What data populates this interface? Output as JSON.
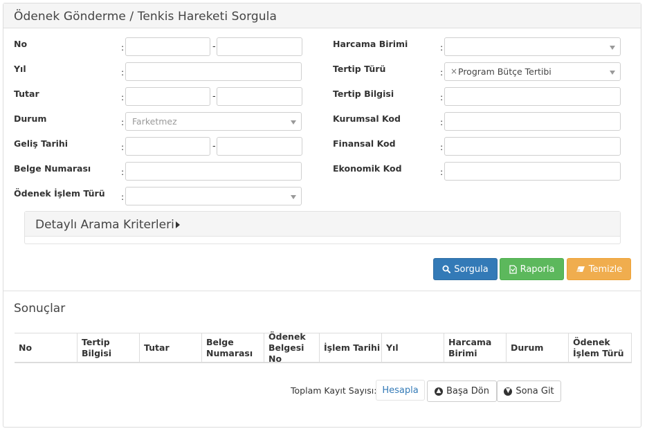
{
  "panel": {
    "title": "Ödenek Gönderme / Tenkis Hareketi Sorgula"
  },
  "form_left": {
    "no": {
      "label": "No",
      "colon": ":",
      "dash": "-"
    },
    "yil": {
      "label": "Yıl",
      "colon": ":"
    },
    "tutar": {
      "label": "Tutar",
      "colon": ":",
      "dash": "-"
    },
    "durum": {
      "label": "Durum",
      "colon": ":",
      "selected": "Farketmez"
    },
    "gelis_tarihi": {
      "label": "Geliş Tarihi",
      "colon": ":",
      "dash": "-"
    },
    "belge_numarasi": {
      "label": "Belge Numarası",
      "colon": ":"
    },
    "odenek_islem_turu": {
      "label": "Ödenek İşlem Türü",
      "colon": ":",
      "selected": ""
    }
  },
  "form_right": {
    "harcama_birimi": {
      "label": "Harcama Birimi",
      "colon": ":",
      "selected": ""
    },
    "tertip_turu": {
      "label": "Tertip Türü",
      "colon": ":",
      "tag_remove": "×",
      "selected": "Program Bütçe Tertibi"
    },
    "tertip_bilgisi": {
      "label": "Tertip Bilgisi",
      "colon": ":"
    },
    "kurumsal_kod": {
      "label": "Kurumsal Kod",
      "colon": ":"
    },
    "finansal_kod": {
      "label": "Finansal Kod",
      "colon": ":"
    },
    "ekonomik_kod": {
      "label": "Ekonomik Kod",
      "colon": ":"
    }
  },
  "detail": {
    "title": "Detaylı Arama Kriterleri"
  },
  "actions": {
    "query_label": "Sorgula",
    "report_label": "Raporla",
    "clear_label": "Temizle"
  },
  "results": {
    "title": "Sonuçlar",
    "columns": [
      "No",
      "Tertip Bilgisi",
      "Tutar",
      "Belge Numarası",
      "Ödenek Belgesi No",
      "İşlem Tarihi",
      "Yıl",
      "Harcama Birimi",
      "Durum",
      "Ödenek İşlem Türü"
    ]
  },
  "footer": {
    "total_label": "Toplam Kayıt Sayısı:",
    "calculate_label": "Hesapla",
    "first_label": "Başa Dön",
    "last_label": "Sona Git"
  },
  "colors": {
    "primary": "#337ab7",
    "success": "#5cb85c",
    "warning": "#f0ad4e",
    "link": "#337ab7"
  }
}
